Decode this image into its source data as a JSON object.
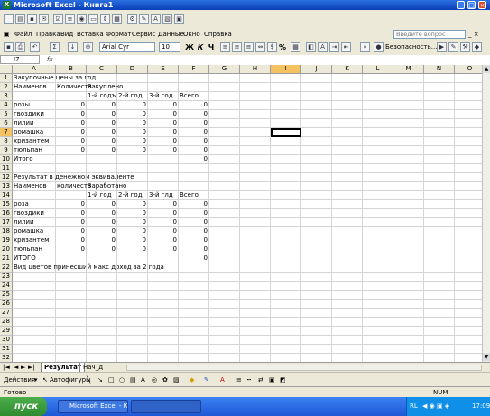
{
  "window": {
    "title": "Microsoft Excel - Книга1"
  },
  "menu": [
    "Файл",
    "Правка",
    "Вид",
    "Вставка",
    "Формат",
    "Сервис",
    "Данные",
    "Окно",
    "Справка"
  ],
  "help_placeholder": "Введите вопрос",
  "format_toolbar": {
    "font_name": "Arial Cyr",
    "font_size": "10",
    "bold": "Ж",
    "italic": "К",
    "underline": "Ч",
    "percent": "%",
    "security": "Безопасность..."
  },
  "formula_bar": {
    "name_box": "I7",
    "fx": "fx"
  },
  "columns": [
    "A",
    "B",
    "C",
    "D",
    "E",
    "F",
    "G",
    "H",
    "I",
    "J",
    "K",
    "L",
    "M",
    "N",
    "O"
  ],
  "active_column": "I",
  "active_row": 7,
  "rows": [
    {
      "n": 1,
      "cells": {
        "A": "Закупочные цены за год"
      }
    },
    {
      "n": 2,
      "cells": {
        "A": "Наименов",
        "B": "Количеств",
        "C": "Закуплено"
      }
    },
    {
      "n": 3,
      "cells": {
        "C": "1-й годъ",
        "D": "2-й год",
        "E": "3-й год",
        "F": "Всего"
      }
    },
    {
      "n": 4,
      "cells": {
        "A": "розы",
        "B": "0",
        "C": "0",
        "D": "0",
        "E": "0",
        "F": "0"
      }
    },
    {
      "n": 5,
      "cells": {
        "A": "гвоздики",
        "B": "0",
        "C": "0",
        "D": "0",
        "E": "0",
        "F": "0"
      }
    },
    {
      "n": 6,
      "cells": {
        "A": "лилии",
        "B": "0",
        "C": "0",
        "D": "0",
        "E": "0",
        "F": "0"
      }
    },
    {
      "n": 7,
      "cells": {
        "A": "ромашка",
        "B": "0",
        "C": "0",
        "D": "0",
        "E": "0",
        "F": "0"
      }
    },
    {
      "n": 8,
      "cells": {
        "A": "хризантем",
        "B": "0",
        "C": "0",
        "D": "0",
        "E": "0",
        "F": "0"
      }
    },
    {
      "n": 9,
      "cells": {
        "A": "тюльпан",
        "B": "0",
        "C": "0",
        "D": "0",
        "E": "0",
        "F": "0"
      }
    },
    {
      "n": 10,
      "cells": {
        "A": "Итого",
        "F": "0"
      }
    },
    {
      "n": 11,
      "cells": {}
    },
    {
      "n": 12,
      "cells": {
        "A": "Результат в денежном эквиваленте"
      }
    },
    {
      "n": 13,
      "cells": {
        "A": "Наименов",
        "B": "количеств",
        "C": "Заработано"
      }
    },
    {
      "n": 14,
      "cells": {
        "C": "1-й год",
        "D": "2-й год",
        "E": "3-й глд",
        "F": "Всего"
      }
    },
    {
      "n": 15,
      "cells": {
        "A": "роза",
        "B": "0",
        "C": "0",
        "D": "0",
        "E": "0",
        "F": "0"
      }
    },
    {
      "n": 16,
      "cells": {
        "A": "гвоздики",
        "B": "0",
        "C": "0",
        "D": "0",
        "E": "0",
        "F": "0"
      }
    },
    {
      "n": 17,
      "cells": {
        "A": "лилии",
        "B": "0",
        "C": "0",
        "D": "0",
        "E": "0",
        "F": "0"
      }
    },
    {
      "n": 18,
      "cells": {
        "A": "ромашка",
        "B": "0",
        "C": "0",
        "D": "0",
        "E": "0",
        "F": "0"
      }
    },
    {
      "n": 19,
      "cells": {
        "A": "хризантем",
        "B": "0",
        "C": "0",
        "D": "0",
        "E": "0",
        "F": "0"
      }
    },
    {
      "n": 20,
      "cells": {
        "A": "тюльпан",
        "B": "0",
        "C": "0",
        "D": "0",
        "E": "0",
        "F": "0"
      }
    },
    {
      "n": 21,
      "cells": {
        "A": "ИТОГО",
        "F": "0"
      }
    },
    {
      "n": 22,
      "cells": {
        "A": "Вид цветов принесший макс доход за 2 года"
      }
    },
    {
      "n": 23,
      "cells": {}
    },
    {
      "n": 24,
      "cells": {}
    },
    {
      "n": 25,
      "cells": {}
    },
    {
      "n": 26,
      "cells": {}
    },
    {
      "n": 27,
      "cells": {}
    },
    {
      "n": 28,
      "cells": {}
    },
    {
      "n": 29,
      "cells": {}
    },
    {
      "n": 30,
      "cells": {}
    },
    {
      "n": 31,
      "cells": {}
    },
    {
      "n": 32,
      "cells": {}
    }
  ],
  "sheet_tabs": [
    {
      "label": "Результат",
      "active": true
    },
    {
      "label": "Нач_д",
      "active": false
    }
  ],
  "drawing_toolbar": {
    "actions": "Действия",
    "autoshapes": "Автофигуры"
  },
  "status": {
    "ready": "Готово",
    "num": "NUM"
  },
  "taskbar": {
    "start": "пуск",
    "excel_task": "Microsoft Excel - Кни...",
    "lang": "RL",
    "clock": "17:09"
  },
  "colors": {
    "selection": "#000000",
    "active_header": "#f4c260",
    "title_blue": "#0a3fb8"
  }
}
